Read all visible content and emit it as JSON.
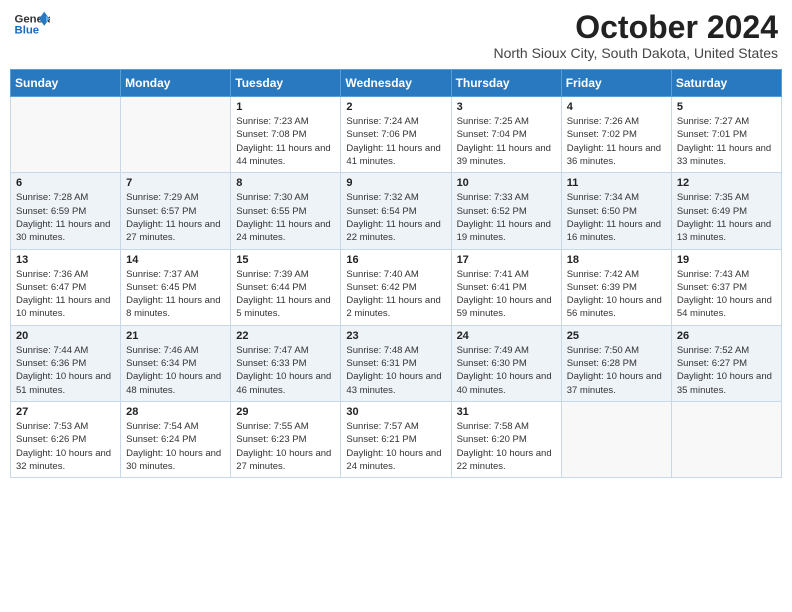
{
  "header": {
    "logo_line1": "General",
    "logo_line2": "Blue",
    "month_title": "October 2024",
    "subtitle": "North Sioux City, South Dakota, United States"
  },
  "days_of_week": [
    "Sunday",
    "Monday",
    "Tuesday",
    "Wednesday",
    "Thursday",
    "Friday",
    "Saturday"
  ],
  "weeks": [
    [
      {
        "day": "",
        "info": ""
      },
      {
        "day": "",
        "info": ""
      },
      {
        "day": "1",
        "info": "Sunrise: 7:23 AM\nSunset: 7:08 PM\nDaylight: 11 hours and 44 minutes."
      },
      {
        "day": "2",
        "info": "Sunrise: 7:24 AM\nSunset: 7:06 PM\nDaylight: 11 hours and 41 minutes."
      },
      {
        "day": "3",
        "info": "Sunrise: 7:25 AM\nSunset: 7:04 PM\nDaylight: 11 hours and 39 minutes."
      },
      {
        "day": "4",
        "info": "Sunrise: 7:26 AM\nSunset: 7:02 PM\nDaylight: 11 hours and 36 minutes."
      },
      {
        "day": "5",
        "info": "Sunrise: 7:27 AM\nSunset: 7:01 PM\nDaylight: 11 hours and 33 minutes."
      }
    ],
    [
      {
        "day": "6",
        "info": "Sunrise: 7:28 AM\nSunset: 6:59 PM\nDaylight: 11 hours and 30 minutes."
      },
      {
        "day": "7",
        "info": "Sunrise: 7:29 AM\nSunset: 6:57 PM\nDaylight: 11 hours and 27 minutes."
      },
      {
        "day": "8",
        "info": "Sunrise: 7:30 AM\nSunset: 6:55 PM\nDaylight: 11 hours and 24 minutes."
      },
      {
        "day": "9",
        "info": "Sunrise: 7:32 AM\nSunset: 6:54 PM\nDaylight: 11 hours and 22 minutes."
      },
      {
        "day": "10",
        "info": "Sunrise: 7:33 AM\nSunset: 6:52 PM\nDaylight: 11 hours and 19 minutes."
      },
      {
        "day": "11",
        "info": "Sunrise: 7:34 AM\nSunset: 6:50 PM\nDaylight: 11 hours and 16 minutes."
      },
      {
        "day": "12",
        "info": "Sunrise: 7:35 AM\nSunset: 6:49 PM\nDaylight: 11 hours and 13 minutes."
      }
    ],
    [
      {
        "day": "13",
        "info": "Sunrise: 7:36 AM\nSunset: 6:47 PM\nDaylight: 11 hours and 10 minutes."
      },
      {
        "day": "14",
        "info": "Sunrise: 7:37 AM\nSunset: 6:45 PM\nDaylight: 11 hours and 8 minutes."
      },
      {
        "day": "15",
        "info": "Sunrise: 7:39 AM\nSunset: 6:44 PM\nDaylight: 11 hours and 5 minutes."
      },
      {
        "day": "16",
        "info": "Sunrise: 7:40 AM\nSunset: 6:42 PM\nDaylight: 11 hours and 2 minutes."
      },
      {
        "day": "17",
        "info": "Sunrise: 7:41 AM\nSunset: 6:41 PM\nDaylight: 10 hours and 59 minutes."
      },
      {
        "day": "18",
        "info": "Sunrise: 7:42 AM\nSunset: 6:39 PM\nDaylight: 10 hours and 56 minutes."
      },
      {
        "day": "19",
        "info": "Sunrise: 7:43 AM\nSunset: 6:37 PM\nDaylight: 10 hours and 54 minutes."
      }
    ],
    [
      {
        "day": "20",
        "info": "Sunrise: 7:44 AM\nSunset: 6:36 PM\nDaylight: 10 hours and 51 minutes."
      },
      {
        "day": "21",
        "info": "Sunrise: 7:46 AM\nSunset: 6:34 PM\nDaylight: 10 hours and 48 minutes."
      },
      {
        "day": "22",
        "info": "Sunrise: 7:47 AM\nSunset: 6:33 PM\nDaylight: 10 hours and 46 minutes."
      },
      {
        "day": "23",
        "info": "Sunrise: 7:48 AM\nSunset: 6:31 PM\nDaylight: 10 hours and 43 minutes."
      },
      {
        "day": "24",
        "info": "Sunrise: 7:49 AM\nSunset: 6:30 PM\nDaylight: 10 hours and 40 minutes."
      },
      {
        "day": "25",
        "info": "Sunrise: 7:50 AM\nSunset: 6:28 PM\nDaylight: 10 hours and 37 minutes."
      },
      {
        "day": "26",
        "info": "Sunrise: 7:52 AM\nSunset: 6:27 PM\nDaylight: 10 hours and 35 minutes."
      }
    ],
    [
      {
        "day": "27",
        "info": "Sunrise: 7:53 AM\nSunset: 6:26 PM\nDaylight: 10 hours and 32 minutes."
      },
      {
        "day": "28",
        "info": "Sunrise: 7:54 AM\nSunset: 6:24 PM\nDaylight: 10 hours and 30 minutes."
      },
      {
        "day": "29",
        "info": "Sunrise: 7:55 AM\nSunset: 6:23 PM\nDaylight: 10 hours and 27 minutes."
      },
      {
        "day": "30",
        "info": "Sunrise: 7:57 AM\nSunset: 6:21 PM\nDaylight: 10 hours and 24 minutes."
      },
      {
        "day": "31",
        "info": "Sunrise: 7:58 AM\nSunset: 6:20 PM\nDaylight: 10 hours and 22 minutes."
      },
      {
        "day": "",
        "info": ""
      },
      {
        "day": "",
        "info": ""
      }
    ]
  ]
}
